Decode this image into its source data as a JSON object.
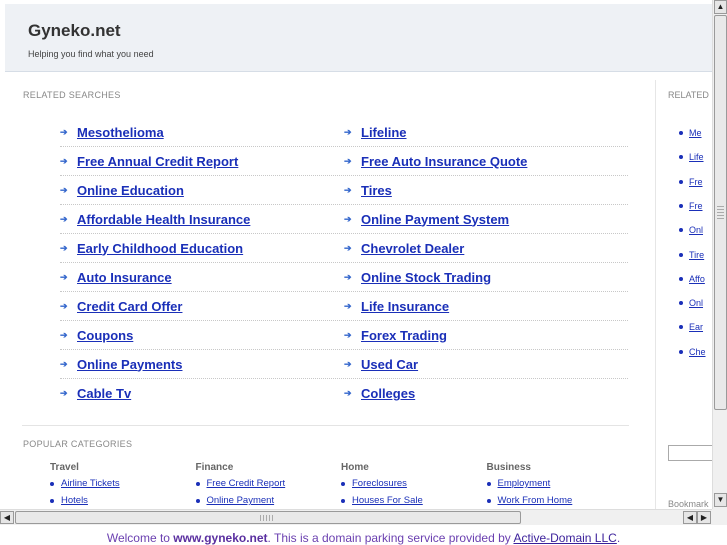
{
  "header": {
    "title": "Gyneko.net",
    "tagline": "Helping you find what you need"
  },
  "related_searches": {
    "heading": "RELATED SEARCHES",
    "rows": [
      [
        "Mesothelioma",
        "Lifeline"
      ],
      [
        "Free Annual Credit Report",
        "Free Auto Insurance Quote"
      ],
      [
        "Online Education",
        "Tires"
      ],
      [
        "Affordable Health Insurance",
        "Online Payment System"
      ],
      [
        "Early Childhood Education",
        "Chevrolet Dealer"
      ],
      [
        "Auto Insurance",
        "Online Stock Trading"
      ],
      [
        "Credit Card Offer",
        "Life Insurance"
      ],
      [
        "Coupons",
        "Forex Trading"
      ],
      [
        "Online Payments",
        "Used Car"
      ],
      [
        "Cable Tv",
        "Colleges"
      ]
    ]
  },
  "right_sidebar": {
    "heading": "RELATED",
    "items": [
      "Me",
      "Life",
      "Fre",
      "Fre",
      "Onl",
      "Tire",
      "Affo",
      "Onl",
      "Ear",
      "Che"
    ],
    "bookmark": "Bookmark"
  },
  "popular_categories": {
    "heading": "POPULAR CATEGORIES",
    "columns": [
      {
        "title": "Travel",
        "items": [
          "Airline Tickets",
          "Hotels"
        ]
      },
      {
        "title": "Finance",
        "items": [
          "Free Credit Report",
          "Online Payment"
        ]
      },
      {
        "title": "Home",
        "items": [
          "Foreclosures",
          "Houses For Sale"
        ]
      },
      {
        "title": "Business",
        "items": [
          "Employment",
          "Work From Home"
        ]
      }
    ]
  },
  "scrollbars": {
    "up_icon": "▲",
    "down_icon": "▼",
    "left_icon": "◀",
    "right_icon": "▶"
  },
  "status": {
    "prefix": "Welcome to ",
    "domain": "www.gyneko.net",
    "middle": ". This is a domain parking service provided by ",
    "provider": "Active-Domain LLC",
    "suffix": "."
  },
  "colors": {
    "link": "#1a2fb8",
    "header_bg": "#eef1f5",
    "status_text": "#6a3fb0"
  }
}
